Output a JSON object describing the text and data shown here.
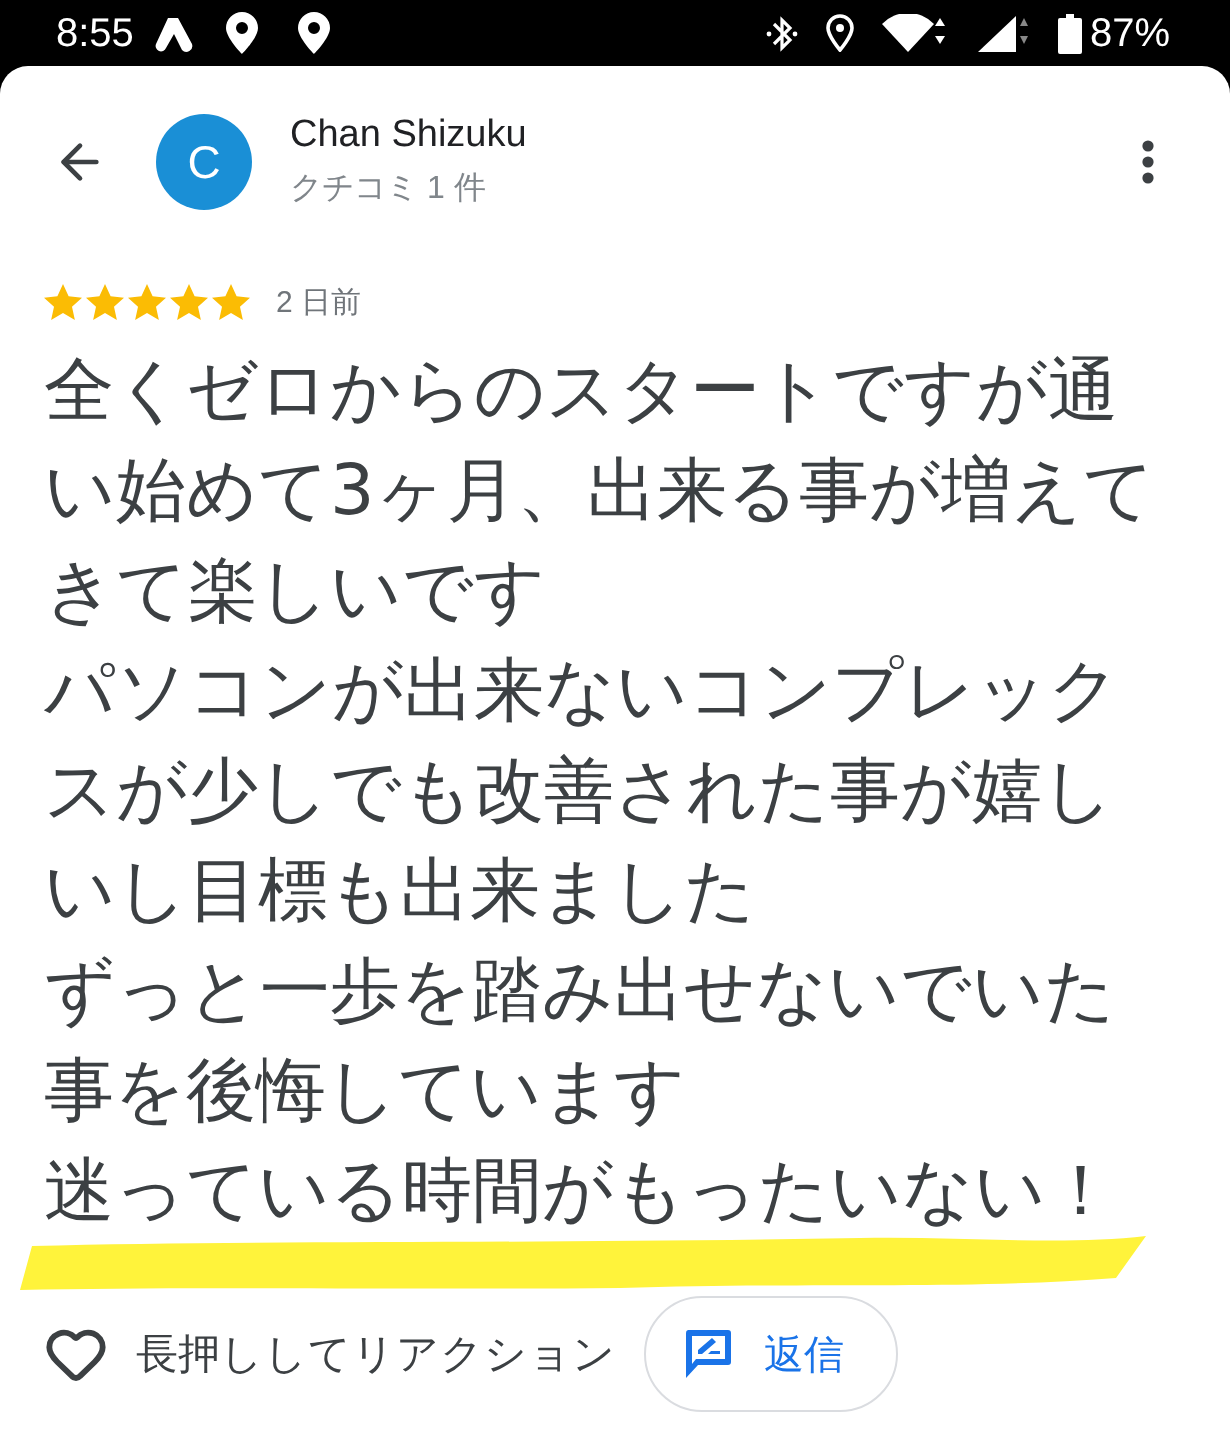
{
  "status_bar": {
    "time": "8:55",
    "battery": "87%"
  },
  "reviewer": {
    "initial": "C",
    "name": "Chan Shizuku",
    "review_count": "クチコミ 1 件"
  },
  "review": {
    "stars": 5,
    "date": "2 日前",
    "paragraphs": [
      "全くゼロからのスタートですが通い始めて3ヶ月、出来る事が増えてきて楽しいです",
      "パソコンが出来ないコンプレックスが少しでも改善された事が嬉しいし目標も出来ました",
      "ずっと一歩を踏み出せないでいた事を後悔しています",
      "迷っている時間がもったいない！"
    ],
    "annotation": {
      "kind": "underline"
    }
  },
  "actions": {
    "reaction": "長押ししてリアクション",
    "reply": "返信"
  }
}
